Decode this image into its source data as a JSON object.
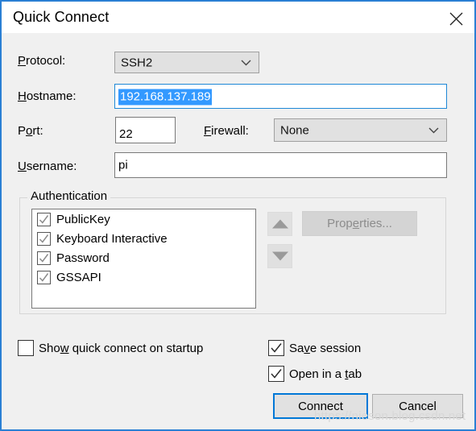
{
  "window": {
    "title": "Quick Connect",
    "close_icon": "close-icon",
    "accent_color": "#2a7fd4",
    "body_color": "#f0f0f0"
  },
  "form": {
    "protocol": {
      "label": "Protocol:",
      "accel": "P",
      "value": "SSH2",
      "chevron_icon": "chevron-down-icon"
    },
    "hostname": {
      "label": "Hostname:",
      "accel": "H",
      "value": "192.168.137.189",
      "selected": true,
      "selection_color": "#3399ff",
      "focus_color": "#1e88d6"
    },
    "port": {
      "label": "Port:",
      "accel": "o",
      "value": "22"
    },
    "firewall": {
      "label": "Firewall:",
      "accel": "F",
      "value": "None",
      "chevron_icon": "chevron-down-icon"
    },
    "username": {
      "label": "Username:",
      "accel": "U",
      "value": "pi"
    }
  },
  "authentication": {
    "legend": "Authentication",
    "items": [
      {
        "label": "PublicKey",
        "checked": true
      },
      {
        "label": "Keyboard Interactive",
        "checked": true
      },
      {
        "label": "Password",
        "checked": true
      },
      {
        "label": "GSSAPI",
        "checked": true
      }
    ],
    "move_up_icon": "triangle-up-icon",
    "move_down_icon": "triangle-down-icon",
    "properties_button": {
      "label_before": "Prop",
      "label_accel": "e",
      "label_after": "rties...",
      "disabled": true
    }
  },
  "options": {
    "show_on_startup": {
      "label_before": "Sho",
      "label_accel": "w",
      "label_after": " quick connect on startup",
      "checked": false
    },
    "save_session": {
      "label_before": "Sa",
      "label_accel": "v",
      "label_after": "e session",
      "checked": true
    },
    "open_in_tab": {
      "label_before": "Open in a ",
      "label_accel": "t",
      "label_after": "ab",
      "checked": true
    }
  },
  "buttons": {
    "connect": "Connect",
    "cancel": "Cancel"
  },
  "watermark": {
    "text": "https://nieson.blog.csdn.net"
  }
}
